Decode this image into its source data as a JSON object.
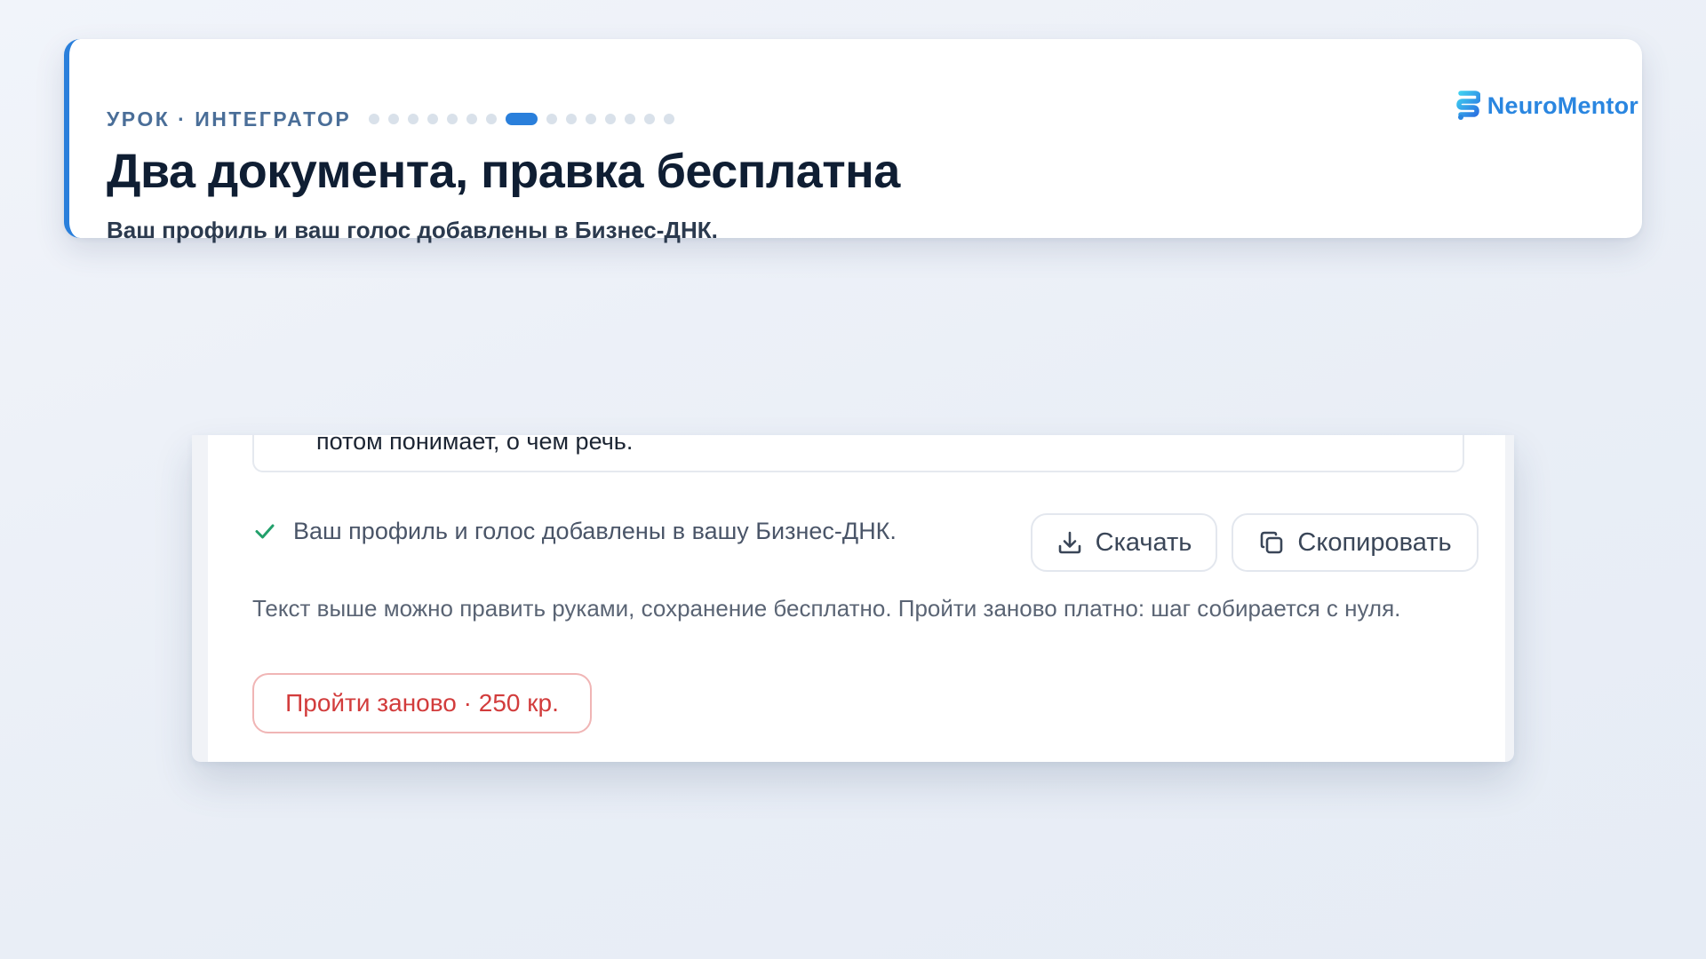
{
  "header": {
    "eyebrow": "УРОК · ИНТЕГРАТОР",
    "progress": {
      "total_steps": 15,
      "current_step": 8
    },
    "title": "Два документа, правка бесплатна",
    "subtitle": "Ваш профиль и ваш голос добавлены в Бизнес-ДНК.",
    "brand": "NeuroMentor"
  },
  "panel": {
    "text_tail": "потом понимает, о чём речь.",
    "status_text": "Ваш профиль и голос добавлены в вашу Бизнес-ДНК.",
    "download_label": "Скачать",
    "copy_label": "Скопировать",
    "note": "Текст выше можно править руками, сохранение бесплатно. Пройти заново платно: шаг собирается с нуля.",
    "redo_label": "Пройти заново · 250 кр."
  },
  "colors": {
    "accent": "#2a7fdb",
    "brand": "#2a86e0",
    "success": "#22a06b",
    "danger": "#d23c3c",
    "title": "#0f1e33"
  },
  "icons": {
    "brand": "neuromentor-logo-icon",
    "status": "check-icon",
    "download": "download-icon",
    "copy": "copy-icon"
  }
}
